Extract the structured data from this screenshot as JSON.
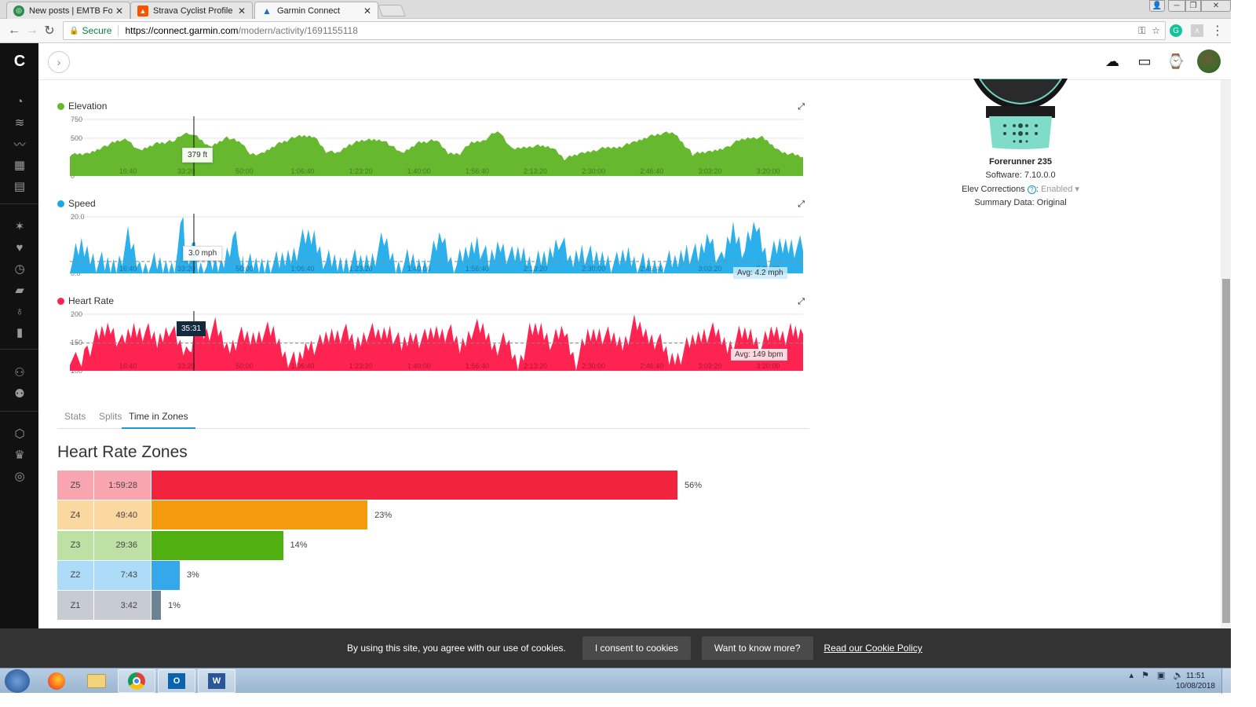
{
  "browser": {
    "tabs": [
      {
        "label": "New posts | EMTB Forum",
        "icon": "emtb-favicon",
        "active": false
      },
      {
        "label": "Strava Cyclist Profile | Tuc",
        "icon": "strava-favicon",
        "active": false
      },
      {
        "label": "Garmin Connect",
        "icon": "garmin-favicon",
        "active": true
      }
    ],
    "close_glyph": "✕",
    "secure_label": "Secure",
    "url_host": "https://connect.garmin.com",
    "url_path": "/modern/activity/1691155118"
  },
  "sidebar": {
    "items": [
      {
        "icon": "dashboard-icon",
        "glyph": "◔"
      },
      {
        "icon": "layers-icon",
        "glyph": "≋"
      },
      {
        "icon": "activity-icon",
        "glyph": "〰"
      },
      {
        "icon": "calendar-icon",
        "glyph": "▦"
      },
      {
        "icon": "news-icon",
        "glyph": "▤"
      },
      {
        "icon": "person-icon",
        "glyph": "✶"
      },
      {
        "icon": "heart-icon",
        "glyph": "♥"
      },
      {
        "icon": "stopwatch-icon",
        "glyph": "◷"
      },
      {
        "icon": "shoe-icon",
        "glyph": "▰"
      },
      {
        "icon": "lightbulb-icon",
        "glyph": "♁"
      },
      {
        "icon": "bar-chart-icon",
        "glyph": "▮"
      },
      {
        "icon": "connections-icon",
        "glyph": "⚇"
      },
      {
        "icon": "groups-icon",
        "glyph": "⚉"
      },
      {
        "icon": "badge-icon",
        "glyph": "⬡"
      },
      {
        "icon": "trophy-icon",
        "glyph": "♛"
      },
      {
        "icon": "target-icon",
        "glyph": "◎"
      }
    ]
  },
  "charts": {
    "elevation": {
      "title": "Elevation",
      "color": "#66b82f",
      "unit": "ft",
      "tooltip": "379 ft"
    },
    "speed": {
      "title": "Speed",
      "color": "#1aa7e6",
      "unit": "mph",
      "tooltip": "3.0 mph",
      "avg_label": "Avg: 4.2 mph"
    },
    "heart_rate": {
      "title": "Heart Rate",
      "color": "#ff2352",
      "unit": "bpm",
      "tooltip": "35:31",
      "avg_label": "Avg: 149 bpm"
    }
  },
  "chart_data": [
    {
      "type": "area",
      "title": "Elevation",
      "ylabel": "ft",
      "ylim": [
        0,
        750
      ],
      "yticks": [
        "0",
        "250",
        "500",
        "750"
      ],
      "xticks": [
        "16:40",
        "33:20",
        "50:00",
        "1:06:40",
        "1:23:20",
        "1:40:00",
        "1:56:40",
        "2:13:20",
        "2:30:00",
        "2:46:40",
        "3:03:20",
        "3:20:00"
      ],
      "xlim_seconds": [
        0,
        12600
      ],
      "x": [
        0,
        300,
        600,
        900,
        1000,
        1200,
        1500,
        1800,
        1950,
        2100,
        2400,
        2700,
        2950,
        3100,
        3300,
        3600,
        3900,
        4200,
        4400,
        4600,
        4800,
        5100,
        5400,
        5700,
        6000,
        6300,
        6500,
        6700,
        6900,
        7100,
        7300,
        7400,
        7600,
        7800,
        8000,
        8300,
        8500,
        8800,
        9000,
        9200,
        9400,
        9700,
        10000,
        10200,
        10400,
        10700,
        11000,
        11300,
        11500,
        11700,
        11900,
        12200,
        12600
      ],
      "values": [
        280,
        290,
        400,
        480,
        480,
        330,
        440,
        460,
        560,
        570,
        380,
        520,
        430,
        300,
        290,
        440,
        520,
        530,
        330,
        300,
        420,
        480,
        480,
        290,
        450,
        470,
        300,
        300,
        440,
        470,
        570,
        580,
        350,
        380,
        400,
        380,
        230,
        300,
        340,
        370,
        380,
        440,
        540,
        570,
        560,
        290,
        320,
        390,
        470,
        510,
        510,
        330,
        250
      ],
      "tooltip": {
        "x": "35:31",
        "value": "379 ft"
      }
    },
    {
      "type": "area",
      "title": "Speed",
      "ylabel": "mph",
      "ylim": [
        0,
        20
      ],
      "yticks": [
        "0.0",
        "20.0"
      ],
      "xticks": [
        "16:40",
        "33:20",
        "50:00",
        "1:06:40",
        "1:23:20",
        "1:40:00",
        "1:56:40",
        "2:13:20",
        "2:30:00",
        "2:46:40",
        "3:03:20",
        "3:20:00"
      ],
      "xlim_seconds": [
        0,
        12600
      ],
      "average": 4.2,
      "average_label": "Avg: 4.2 mph",
      "x": [
        0,
        200,
        400,
        600,
        800,
        1000,
        1200,
        1400,
        1600,
        1800,
        1950,
        2000,
        2100,
        2200,
        2400,
        2600,
        2800,
        2950,
        3000,
        3200,
        3400,
        3600,
        3800,
        4000,
        4200,
        4400,
        4600,
        4800,
        5000,
        5200,
        5400,
        5600,
        5800,
        6000,
        6200,
        6400,
        6600,
        6800,
        7000,
        7200,
        7400,
        7600,
        7800,
        8000,
        8200,
        8400,
        8600,
        8800,
        9000,
        9200,
        9400,
        9600,
        9800,
        10000,
        10200,
        10400,
        10600,
        10800,
        11000,
        11200,
        11400,
        11600,
        11800,
        12000,
        12200,
        12400,
        12600
      ],
      "values": [
        3,
        9,
        6,
        2,
        3,
        12,
        2,
        3,
        2,
        3,
        18,
        4,
        12,
        3,
        2,
        3,
        13,
        5,
        3,
        2,
        4,
        3,
        7,
        11,
        13,
        4,
        3,
        5,
        3,
        6,
        11,
        3,
        4,
        3,
        5,
        13,
        2,
        6,
        12,
        3,
        11,
        5,
        7,
        3,
        5,
        13,
        3,
        9,
        4,
        6,
        3,
        7,
        3,
        2,
        4,
        3,
        9,
        5,
        14,
        3,
        16,
        8,
        17,
        5,
        9,
        11,
        8
      ],
      "tooltip": {
        "x": "35:31",
        "value": "3.0 mph"
      }
    },
    {
      "type": "area",
      "title": "Heart Rate",
      "ylabel": "bpm",
      "ylim": [
        100,
        200
      ],
      "yticks": [
        "100",
        "150",
        "200"
      ],
      "xticks": [
        "16:40",
        "33:20",
        "50:00",
        "1:06:40",
        "1:23:20",
        "1:40:00",
        "1:56:40",
        "2:13:20",
        "2:30:00",
        "2:46:40",
        "3:03:20",
        "3:20:00"
      ],
      "xlim_seconds": [
        0,
        12600
      ],
      "average": 149,
      "average_label": "Avg: 149 bpm",
      "x": [
        0,
        150,
        300,
        500,
        700,
        900,
        1100,
        1300,
        1500,
        1700,
        1900,
        2050,
        2131,
        2300,
        2500,
        2700,
        2900,
        3100,
        3300,
        3500,
        3700,
        3900,
        4100,
        4300,
        4500,
        4700,
        4900,
        5100,
        5300,
        5500,
        5700,
        5900,
        6100,
        6300,
        6500,
        6700,
        6900,
        7100,
        7300,
        7500,
        7700,
        7900,
        8100,
        8300,
        8500,
        8700,
        8900,
        9100,
        9300,
        9500,
        9700,
        9900,
        10100,
        10300,
        10500,
        10700,
        10900,
        11100,
        11300,
        11500,
        11700,
        11900,
        12100,
        12300,
        12600
      ],
      "values": [
        130,
        105,
        140,
        160,
        180,
        145,
        175,
        170,
        150,
        180,
        140,
        130,
        175,
        170,
        175,
        140,
        160,
        155,
        170,
        165,
        130,
        110,
        150,
        145,
        165,
        170,
        145,
        170,
        160,
        175,
        140,
        165,
        155,
        170,
        170,
        140,
        175,
        170,
        145,
        150,
        110,
        165,
        175,
        150,
        170,
        115,
        160,
        170,
        155,
        150,
        180,
        165,
        155,
        120,
        130,
        150,
        170,
        165,
        145,
        160,
        165,
        145,
        170,
        165,
        165
      ],
      "tooltip": {
        "x": "35:31"
      }
    },
    {
      "type": "bar",
      "title": "Heart Rate Zones",
      "categories": [
        "Z5",
        "Z4",
        "Z3",
        "Z2",
        "Z1"
      ],
      "times": [
        "1:59:28",
        "49:40",
        "29:36",
        "7:43",
        "3:42"
      ],
      "values": [
        56,
        23,
        14,
        3,
        1
      ],
      "unit": "%"
    }
  ],
  "device": {
    "name": "Forerunner 235",
    "software": "Software: 7.10.0.0",
    "elev_label": "Elev Corrections",
    "elev_value": "Enabled",
    "summary": "Summary Data: Original"
  },
  "subtabs": [
    {
      "label": "Stats",
      "active": false
    },
    {
      "label": "Splits",
      "active": false
    },
    {
      "label": "Time in Zones",
      "active": true
    }
  ],
  "zones": {
    "title": "Heart Rate Zones",
    "rows": [
      {
        "zone": "Z5",
        "time": "1:59:28",
        "percent": 56,
        "percent_label": "56%",
        "bar": "#f2233d",
        "cell": "#f8a5b0"
      },
      {
        "zone": "Z4",
        "time": "49:40",
        "percent": 23,
        "percent_label": "23%",
        "bar": "#f59a0f",
        "cell": "#fbd8a0"
      },
      {
        "zone": "Z3",
        "time": "29:36",
        "percent": 14,
        "percent_label": "14%",
        "bar": "#50b012",
        "cell": "#bde0a5"
      },
      {
        "zone": "Z2",
        "time": "7:43",
        "percent": 3,
        "percent_label": "3%",
        "bar": "#35a8ec",
        "cell": "#acdcf8"
      },
      {
        "zone": "Z1",
        "time": "3:42",
        "percent": 1,
        "percent_label": "1%",
        "bar": "#6d8293",
        "cell": "#c6ccd2"
      }
    ]
  },
  "cookie": {
    "text": "By using this site, you agree with our use of cookies.",
    "consent": "I consent to cookies",
    "more": "Want to know more?",
    "policy": "Read our Cookie Policy"
  },
  "taskbar": {
    "time": "11:51",
    "date": "10/08/2018"
  }
}
